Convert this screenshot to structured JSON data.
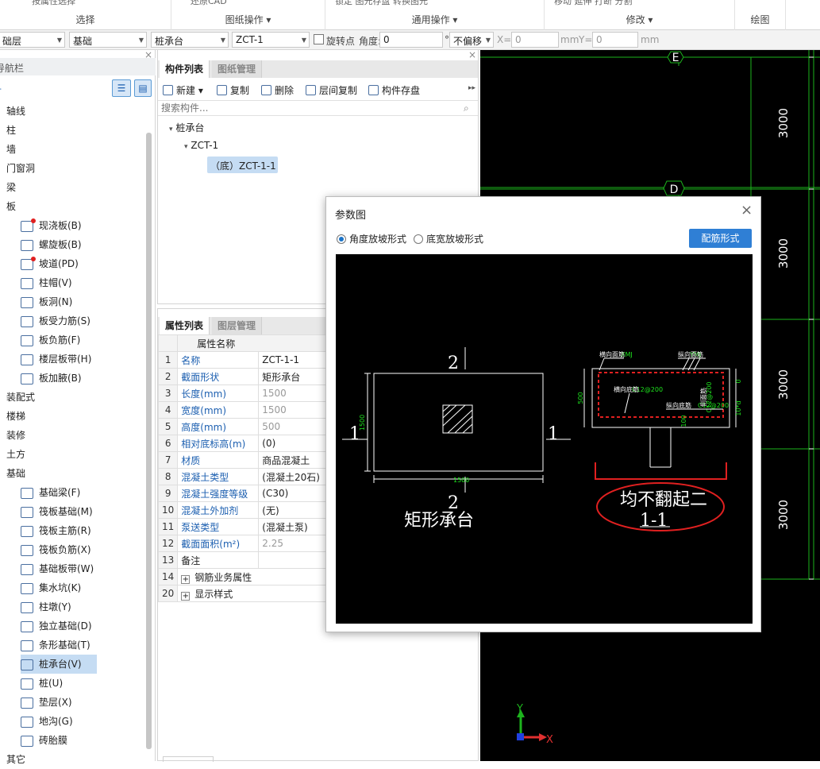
{
  "ribbon": {
    "groups": [
      {
        "label": "选择",
        "cut": "按属性选择"
      },
      {
        "label": "图纸操作",
        "cut": "还原CAD"
      },
      {
        "label": "通用操作",
        "cut": "锁定   图元存盘   转换图元"
      },
      {
        "label": "修改",
        "cut": "移动   延伸   打断   分割"
      },
      {
        "label": "绘图",
        "cut": ""
      }
    ]
  },
  "propbar": {
    "floor": "础层",
    "category": "基础",
    "type": "桩承台",
    "component": "ZCT-1",
    "rotate_label": "旋转点",
    "angle_label": "角度:",
    "angle_value": "0",
    "degree": "°",
    "offset_value": "不偏移",
    "x_label": "X=",
    "x_value": "0",
    "mm1": "mm",
    "y_label": "Y=",
    "y_value": "0",
    "mm2": "mm"
  },
  "nav": {
    "title": "导航栏",
    "items": [
      {
        "label": "轴线",
        "level": 0
      },
      {
        "label": "柱",
        "level": 0
      },
      {
        "label": "墙",
        "level": 0
      },
      {
        "label": "门窗洞",
        "level": 0
      },
      {
        "label": "梁",
        "level": 0
      },
      {
        "label": "板",
        "level": 0
      },
      {
        "label": "现浇板(B)",
        "level": 1,
        "dot": true
      },
      {
        "label": "螺旋板(B)",
        "level": 1
      },
      {
        "label": "坡道(PD)",
        "level": 1,
        "dot": true
      },
      {
        "label": "柱帽(V)",
        "level": 1
      },
      {
        "label": "板洞(N)",
        "level": 1
      },
      {
        "label": "板受力筋(S)",
        "level": 1
      },
      {
        "label": "板负筋(F)",
        "level": 1
      },
      {
        "label": "楼层板带(H)",
        "level": 1
      },
      {
        "label": "板加腋(B)",
        "level": 1
      },
      {
        "label": "装配式",
        "level": 0
      },
      {
        "label": "楼梯",
        "level": 0
      },
      {
        "label": "装修",
        "level": 0
      },
      {
        "label": "土方",
        "level": 0
      },
      {
        "label": "基础",
        "level": 0
      },
      {
        "label": "基础梁(F)",
        "level": 1
      },
      {
        "label": "筏板基础(M)",
        "level": 1
      },
      {
        "label": "筏板主筋(R)",
        "level": 1
      },
      {
        "label": "筏板负筋(X)",
        "level": 1
      },
      {
        "label": "基础板带(W)",
        "level": 1
      },
      {
        "label": "集水坑(K)",
        "level": 1
      },
      {
        "label": "柱墩(Y)",
        "level": 1
      },
      {
        "label": "独立基础(D)",
        "level": 1
      },
      {
        "label": "条形基础(T)",
        "level": 1
      },
      {
        "label": "桩承台(V)",
        "level": 1,
        "selected": true
      },
      {
        "label": "桩(U)",
        "level": 1
      },
      {
        "label": "垫层(X)",
        "level": 1
      },
      {
        "label": "地沟(G)",
        "level": 1
      },
      {
        "label": "砖胎膜",
        "level": 1
      },
      {
        "label": "其它",
        "level": 0
      }
    ]
  },
  "component_panel": {
    "tabs": [
      "构件列表",
      "图纸管理"
    ],
    "toolbar": [
      "新建",
      "复制",
      "删除",
      "层间复制",
      "构件存盘"
    ],
    "search_placeholder": "搜索构件...",
    "tree": [
      "桩承台",
      "ZCT-1",
      "（底）ZCT-1-1"
    ]
  },
  "property_panel": {
    "tabs": [
      "属性列表",
      "图层管理"
    ],
    "header": "属性名称",
    "rows": [
      {
        "n": "1",
        "name": "名称",
        "value": "ZCT-1-1",
        "blue": true
      },
      {
        "n": "2",
        "name": "截面形状",
        "value": "矩形承台",
        "blue": true
      },
      {
        "n": "3",
        "name": "长度(mm)",
        "value": "1500",
        "blue": true,
        "gray": true
      },
      {
        "n": "4",
        "name": "宽度(mm)",
        "value": "1500",
        "blue": true,
        "gray": true
      },
      {
        "n": "5",
        "name": "高度(mm)",
        "value": "500",
        "blue": true,
        "gray": true
      },
      {
        "n": "6",
        "name": "相对底标高(m)",
        "value": "(0)",
        "blue": true
      },
      {
        "n": "7",
        "name": "材质",
        "value": "商品混凝土",
        "blue": true
      },
      {
        "n": "8",
        "name": "混凝土类型",
        "value": "(混凝土20石)",
        "blue": true
      },
      {
        "n": "9",
        "name": "混凝土强度等级",
        "value": "(C30)",
        "blue": true
      },
      {
        "n": "10",
        "name": "混凝土外加剂",
        "value": "(无)",
        "blue": true
      },
      {
        "n": "11",
        "name": "泵送类型",
        "value": "(混凝土泵)",
        "blue": true
      },
      {
        "n": "12",
        "name": "截面面积(m²)",
        "value": "2.25",
        "blue": true,
        "gray": true
      },
      {
        "n": "13",
        "name": "备注",
        "value": "",
        "blue": false
      },
      {
        "n": "14",
        "name": "钢筋业务属性",
        "value": "",
        "blue": false,
        "expand": true
      },
      {
        "n": "20",
        "name": "显示样式",
        "value": "",
        "blue": false,
        "expand": true
      }
    ]
  },
  "cad": {
    "axis_labels": [
      "E",
      "D"
    ],
    "dims": [
      "3000",
      "3000",
      "3000",
      "3000"
    ],
    "ucs_x": "X",
    "ucs_y": "Y"
  },
  "dialog": {
    "title": "参数图",
    "radio1": "角度放坡形式",
    "radio2": "底宽放坡形式",
    "button": "配筋形式",
    "drawing": {
      "sec_top": "2",
      "sec_bottom": "2",
      "sec_left": "1",
      "sec_right": "1",
      "dim_v": "1500",
      "dim_h": "1500",
      "caption": "矩形承台",
      "lbl_a": "横向面筋",
      "lbl_a2": "XMJ",
      "lbl_b": "纵向面筋",
      "lbl_b2": "YMJ",
      "lbl_c": "横向底筋",
      "lbl_c2": "C12@200",
      "lbl_d": "纵向底筋",
      "lbl_d2": "C12@200",
      "lbl_e": "侧面筋",
      "lbl_e2": "C12@200",
      "lbl_h": "500",
      "lbl_f": "100",
      "lbl_g": "0",
      "lbl_k": "10*d",
      "section_label": "1-1",
      "annotation": "均不翻起二"
    }
  }
}
